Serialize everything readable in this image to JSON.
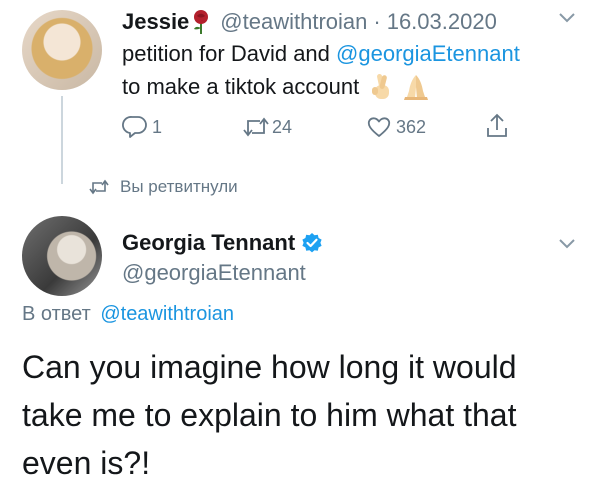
{
  "tweet1": {
    "author_name": "Jessie",
    "handle": "@teawithtroian",
    "separator": "·",
    "date": "16.03.2020",
    "text_line1_prefix": "petition for David and ",
    "text_line1_mention": "@georgiaEtennant",
    "text_line2": "to make a tiktok account",
    "reply_count": "1",
    "retweet_count": "24",
    "like_count": "362"
  },
  "retweet_notice": "Вы ретвитнули",
  "tweet2": {
    "author_name": "Georgia Tennant",
    "handle": "@georgiaEtennant",
    "reply_to_prefix": "В ответ",
    "reply_to_mention": "@teawithtroian",
    "body_line1": "Can you imagine how long it would",
    "body_line2": "take me to explain to him what that",
    "body_line3": "even is?!"
  },
  "colors": {
    "accent": "#1b95e0",
    "muted": "#657786",
    "text": "#14171a",
    "thread_line": "#ccd6dd",
    "verified": "#1da1f2"
  },
  "icons": [
    "rose-emoji-icon",
    "chevron-down-icon",
    "reply-icon",
    "retweet-icon",
    "like-icon",
    "share-icon",
    "crossed-fingers-emoji-icon",
    "folded-hands-emoji-icon",
    "verified-badge-icon"
  ]
}
